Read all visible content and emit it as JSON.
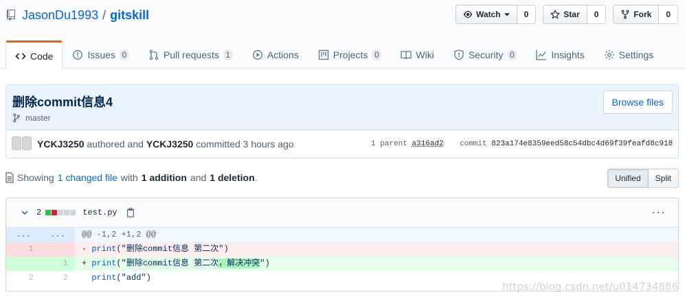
{
  "repo": {
    "owner": "JasonDu1993",
    "separator": "/",
    "name": "gitskill"
  },
  "actions": {
    "watch": {
      "label": "Watch",
      "count": "0"
    },
    "star": {
      "label": "Star",
      "count": "0"
    },
    "fork": {
      "label": "Fork",
      "count": "0"
    }
  },
  "nav": {
    "code": {
      "label": "Code"
    },
    "issues": {
      "label": "Issues",
      "count": "0"
    },
    "pulls": {
      "label": "Pull requests",
      "count": "1"
    },
    "actions": {
      "label": "Actions"
    },
    "projects": {
      "label": "Projects",
      "count": "0"
    },
    "wiki": {
      "label": "Wiki"
    },
    "security": {
      "label": "Security",
      "count": "0"
    },
    "insights": {
      "label": "Insights"
    },
    "settings": {
      "label": "Settings"
    }
  },
  "commit": {
    "title": "删除commit信息4",
    "branch": "master",
    "browse_label": "Browse files",
    "author": "YCKJ3250",
    "authored_text": "authored and",
    "committer": "YCKJ3250",
    "committed_text": "committed 3 hours ago",
    "parent_label": "1 parent",
    "parent_sha": "a316ad2",
    "commit_label": "commit",
    "commit_sha": "823a174e8359eed58c54dbc4d69f39feafd8c918"
  },
  "toc": {
    "showing": "Showing",
    "changed": "1 changed file",
    "with": "with",
    "additions": "1 addition",
    "and": "and",
    "deletions": "1 deletion",
    "period": ".",
    "unified": "Unified",
    "split": "Split"
  },
  "file": {
    "changes": "2",
    "name": "test.py",
    "more": "···",
    "diffstat_colors": [
      "#2cbe4e",
      "#cb2431",
      "#d1d5da",
      "#d1d5da",
      "#d1d5da"
    ]
  },
  "diff": {
    "hunk": {
      "old": "...",
      "new": "...",
      "text": "@@ -1,2 +1,2 @@"
    },
    "del": {
      "old": "1",
      "new": "",
      "prefix": "- ",
      "fn": "print",
      "open": "(",
      "str": "\"删除commit信息 第二次\"",
      "close": ")"
    },
    "add": {
      "old": "",
      "new": "1",
      "prefix": "+ ",
      "fn": "print",
      "open": "(",
      "str_a": "\"删除commit信息 第二次",
      "str_hl": "，解决冲突",
      "str_b": "\"",
      "close": ")"
    },
    "ctx": {
      "old": "2",
      "new": "2",
      "prefix": "  ",
      "fn": "print",
      "open": "(",
      "str": "\"add\"",
      "close": ")"
    }
  },
  "watermark": "https://blog.csdn.net/u014734886"
}
